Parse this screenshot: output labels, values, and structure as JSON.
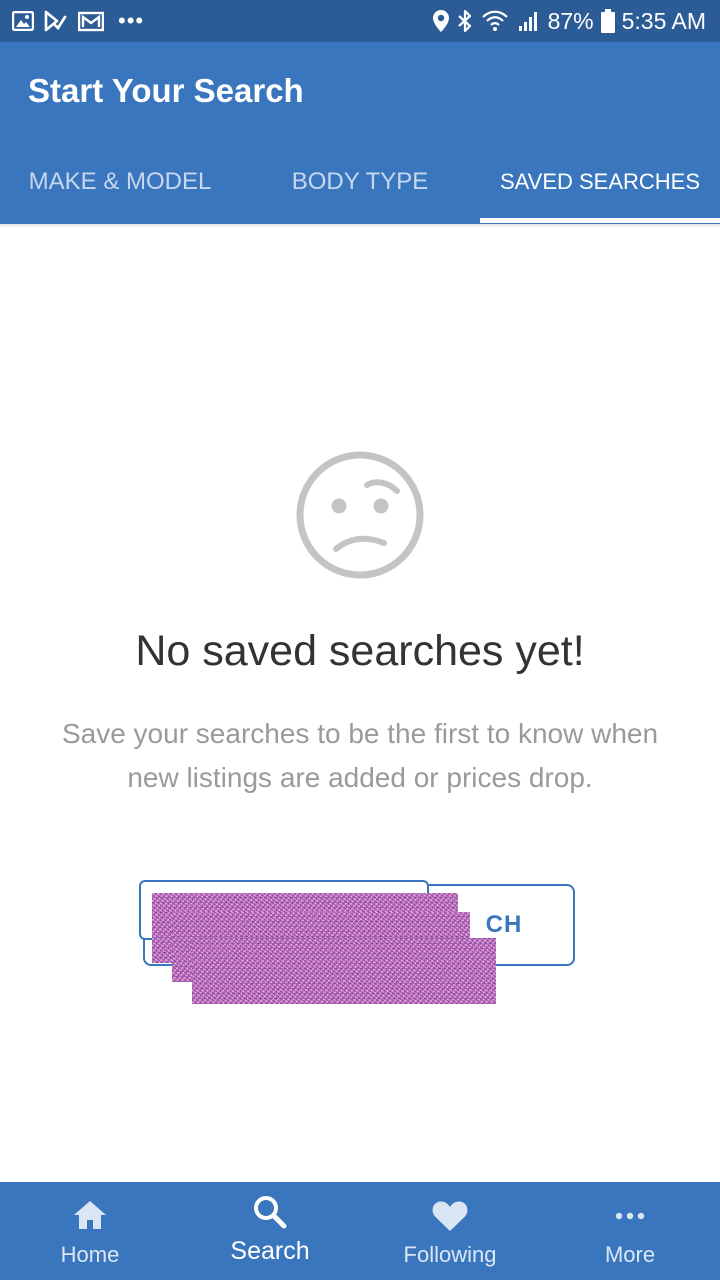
{
  "status_bar": {
    "left_icons": [
      "gallery-icon",
      "play-store-icon",
      "gmail-icon",
      "more-notifications-icon"
    ],
    "more_indicator": "•••",
    "right_icons": [
      "location-icon",
      "bluetooth-icon",
      "wifi-icon",
      "signal-icon",
      "battery-icon"
    ],
    "battery": "87%",
    "time": "5:35 AM"
  },
  "app_bar": {
    "title": "Start Your Search",
    "tabs": [
      {
        "label": "MAKE & MODEL",
        "active": false
      },
      {
        "label": "BODY TYPE",
        "active": false
      },
      {
        "label": "SAVED SEARCHES",
        "active": true
      }
    ]
  },
  "empty_state": {
    "icon": "confused-face-icon",
    "title": "No saved searches yet!",
    "message": "Save your searches to be the first to know when new listings are added or prices drop.",
    "button_label_visible": "CH"
  },
  "bottom_nav": {
    "items": [
      {
        "label": "Home",
        "icon": "home-icon",
        "active": false
      },
      {
        "label": "Search",
        "icon": "search-icon",
        "active": true
      },
      {
        "label": "Following",
        "icon": "heart-icon",
        "active": false
      },
      {
        "label": "More",
        "icon": "more-icon",
        "active": false
      }
    ]
  },
  "colors": {
    "status_bar": "#2c5c96",
    "primary": "#3a76bd",
    "title_text": "#333333",
    "muted_text": "#9a9a9a",
    "face_icon": "#c4c4c4"
  }
}
